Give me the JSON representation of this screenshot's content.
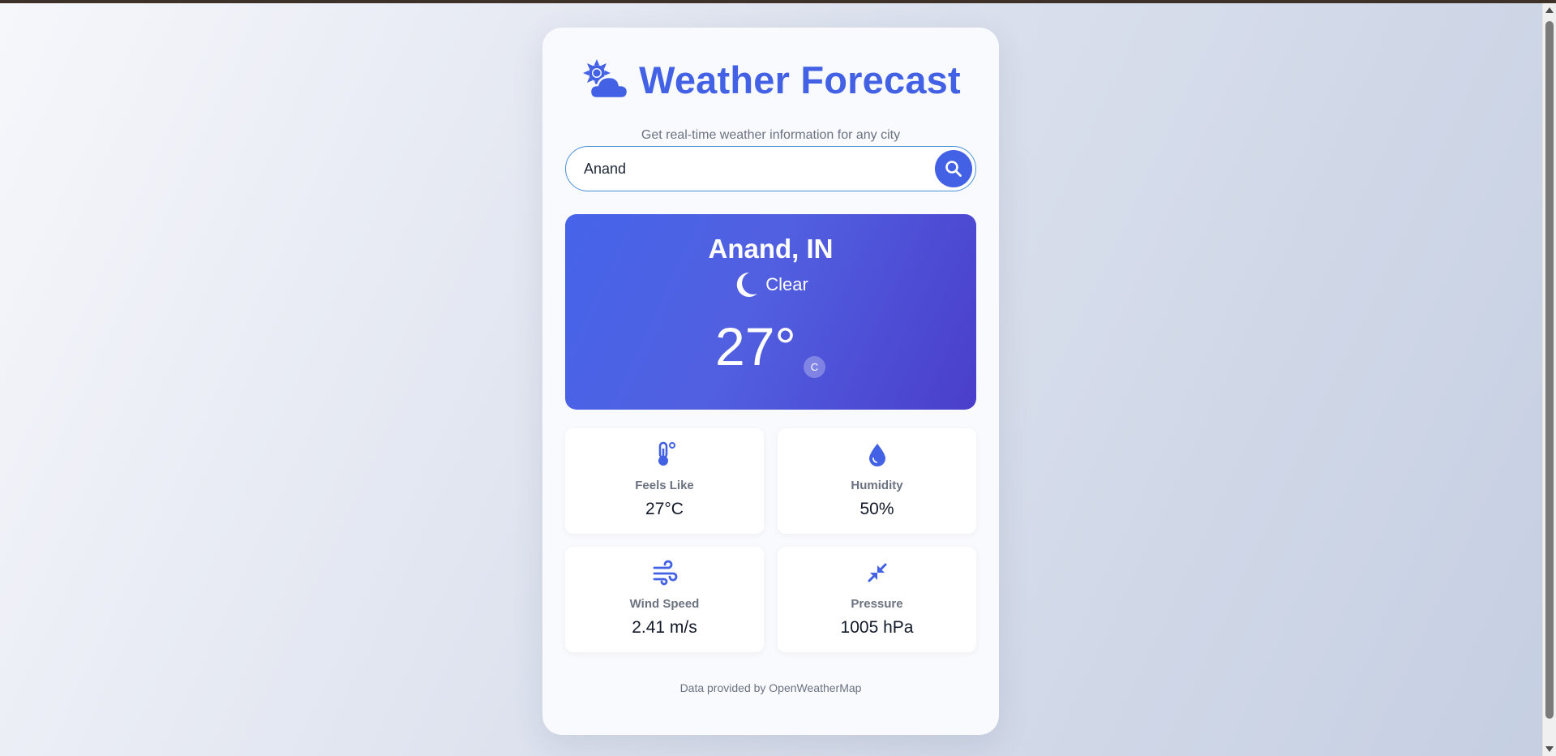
{
  "header": {
    "title": "Weather Forecast",
    "subtitle": "Get real-time weather information for any city",
    "logo_icon": "sun-cloud-icon"
  },
  "search": {
    "value": "Anand",
    "button_icon": "search-icon"
  },
  "current": {
    "city": "Anand, IN",
    "condition": "Clear",
    "condition_icon": "moon-icon",
    "temperature": "27°",
    "unit": "C"
  },
  "details": [
    {
      "label": "Feels Like",
      "value": "27°C",
      "icon": "thermometer-icon"
    },
    {
      "label": "Humidity",
      "value": "50%",
      "icon": "droplet-icon"
    },
    {
      "label": "Wind Speed",
      "value": "2.41 m/s",
      "icon": "wind-icon"
    },
    {
      "label": "Pressure",
      "value": "1005 hPa",
      "icon": "compress-arrows-icon"
    }
  ],
  "footer": {
    "credit": "Data provided by OpenWeatherMap"
  },
  "colors": {
    "accent": "#4361e4",
    "card_gradient_start": "#4664ea",
    "card_gradient_end": "#4a3ecb"
  }
}
